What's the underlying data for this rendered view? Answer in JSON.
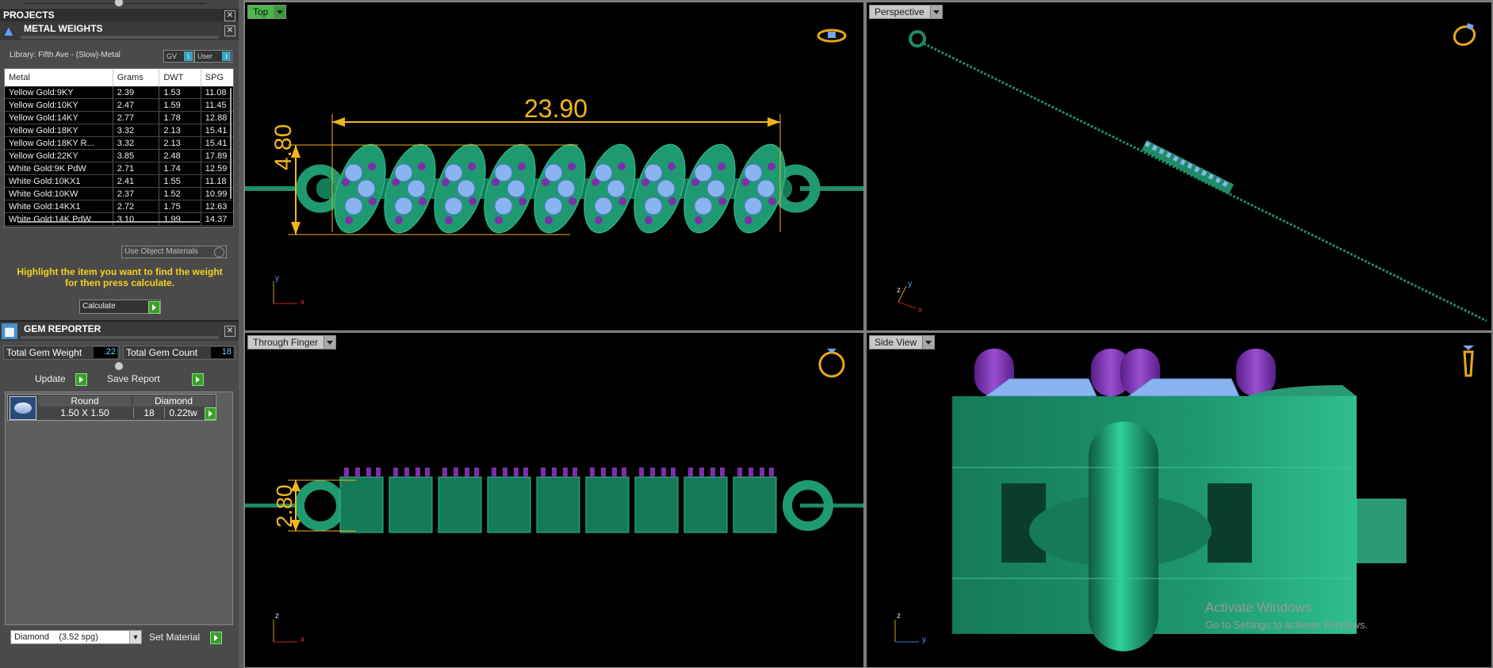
{
  "projects": {
    "title": "PROJECTS"
  },
  "metal_weights": {
    "title": "METAL WEIGHTS",
    "library": "Library: Fifth Ave - (Slow)-Metal",
    "gv_label": "GV",
    "user_label": "User",
    "columns": [
      "Metal",
      "Grams",
      "DWT",
      "SPG"
    ],
    "rows": [
      [
        "Yellow Gold:9KY",
        "2.39",
        "1.53",
        "11.08"
      ],
      [
        "Yellow Gold:10KY",
        "2.47",
        "1.59",
        "11.45"
      ],
      [
        "Yellow Gold:14KY",
        "2.77",
        "1.78",
        "12.88"
      ],
      [
        "Yellow Gold:18KY",
        "3.32",
        "2.13",
        "15.41"
      ],
      [
        "Yellow Gold:18KY R...",
        "3.32",
        "2.13",
        "15.41"
      ],
      [
        "Yellow Gold:22KY",
        "3.85",
        "2.48",
        "17.89"
      ],
      [
        "White Gold:9K PdW",
        "2.71",
        "1.74",
        "12.59"
      ],
      [
        "White Gold:10KX1",
        "2.41",
        "1.55",
        "11.18"
      ],
      [
        "White Gold:10KW",
        "2.37",
        "1.52",
        "10.99"
      ],
      [
        "White Gold:14KX1",
        "2.72",
        "1.75",
        "12.63"
      ],
      [
        "White Gold:14K PdW",
        "3.10",
        "1.99",
        "14.37"
      ]
    ],
    "use_object_materials": "Use Object Materials",
    "hint": "Highlight the item you want to find the weight for then press calculate.",
    "calculate_label": "Calculate"
  },
  "gem_reporter": {
    "title": "GEM REPORTER",
    "total_weight_label": "Total Gem Weight",
    "total_weight_value": ".22",
    "total_count_label": "Total Gem Count",
    "total_count_value": "18",
    "update_label": "Update",
    "save_report_label": "Save Report",
    "gem": {
      "shape": "Round",
      "size": "1.50 X 1.50",
      "material": "Diamond",
      "count": "18",
      "weight": "0.22tw"
    },
    "material_select": "Diamond    (3.52 spg)",
    "set_material_label": "Set Material"
  },
  "viewports": {
    "top": {
      "label": "Top",
      "dim_width": "23.90",
      "dim_height": "4.80",
      "axis_1": "y",
      "axis_2": "x"
    },
    "perspective": {
      "label": "Perspective",
      "axis_1": "y",
      "axis_2": "z",
      "axis_3": "x"
    },
    "through_finger": {
      "label": "Through Finger",
      "dim_height": "2.80",
      "axis_1": "z",
      "axis_2": "x"
    },
    "side_view": {
      "label": "Side View",
      "axis_1": "z",
      "axis_2": "y"
    }
  },
  "watermark": {
    "line1": "Activate Windows",
    "line2": "Go to Settings to activate Windows."
  },
  "colors": {
    "accent_gold": "#f3b51c",
    "model_green": "#1f8c66",
    "gem_blue": "#8ab4f0",
    "prong_purple": "#7b2fa8"
  }
}
